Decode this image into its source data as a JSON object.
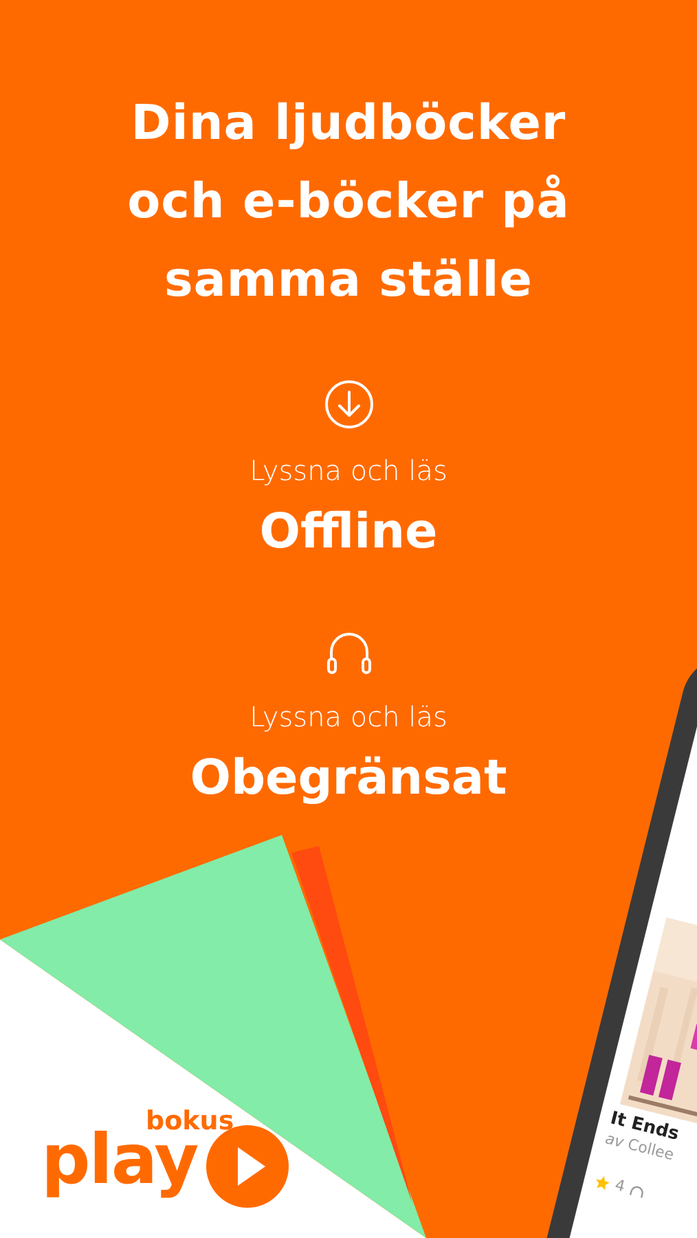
{
  "headline": [
    "Dina ljudböcker",
    "och e-böcker på",
    "samma ställe"
  ],
  "features": [
    {
      "kind": "download",
      "caption": "Lyssna och läs",
      "title": "Offline"
    },
    {
      "kind": "headphones",
      "caption": "Lyssna och läs",
      "title": "Obegränsat"
    }
  ],
  "phone": {
    "book": {
      "title": "It Ends",
      "author": "*av* Collee",
      "rating": "4"
    }
  },
  "logo": {
    "brand": "bokus",
    "product": "play"
  }
}
